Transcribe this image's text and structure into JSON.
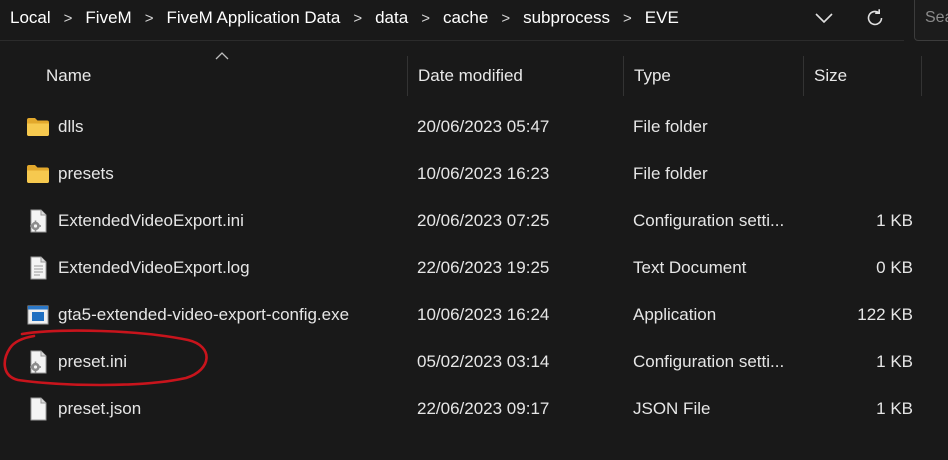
{
  "breadcrumb": [
    "Local",
    "FiveM",
    "FiveM Application Data",
    "data",
    "cache",
    "subprocess",
    "EVE"
  ],
  "breadcrumb_separator": ">",
  "search": {
    "placeholder": "Search EVE"
  },
  "columns": {
    "name": "Name",
    "date": "Date modified",
    "type": "Type",
    "size": "Size"
  },
  "files": [
    {
      "name": "dlls",
      "date": "20/06/2023 05:47",
      "type": "File folder",
      "size": "",
      "icon": "folder-icon"
    },
    {
      "name": "presets",
      "date": "10/06/2023 16:23",
      "type": "File folder",
      "size": "",
      "icon": "folder-icon"
    },
    {
      "name": "ExtendedVideoExport.ini",
      "date": "20/06/2023 07:25",
      "type": "Configuration setti...",
      "size": "1 KB",
      "icon": "config-file-icon"
    },
    {
      "name": "ExtendedVideoExport.log",
      "date": "22/06/2023 19:25",
      "type": "Text Document",
      "size": "0 KB",
      "icon": "text-file-icon"
    },
    {
      "name": "gta5-extended-video-export-config.exe",
      "date": "10/06/2023 16:24",
      "type": "Application",
      "size": "122 KB",
      "icon": "application-icon"
    },
    {
      "name": "preset.ini",
      "date": "05/02/2023 03:14",
      "type": "Configuration setti...",
      "size": "1 KB",
      "icon": "config-file-icon"
    },
    {
      "name": "preset.json",
      "date": "22/06/2023 09:17",
      "type": "JSON File",
      "size": "1 KB",
      "icon": "generic-file-icon"
    }
  ],
  "colors": {
    "background": "#191919",
    "folder": "#f4c44f",
    "annotation": "#c8141c"
  }
}
